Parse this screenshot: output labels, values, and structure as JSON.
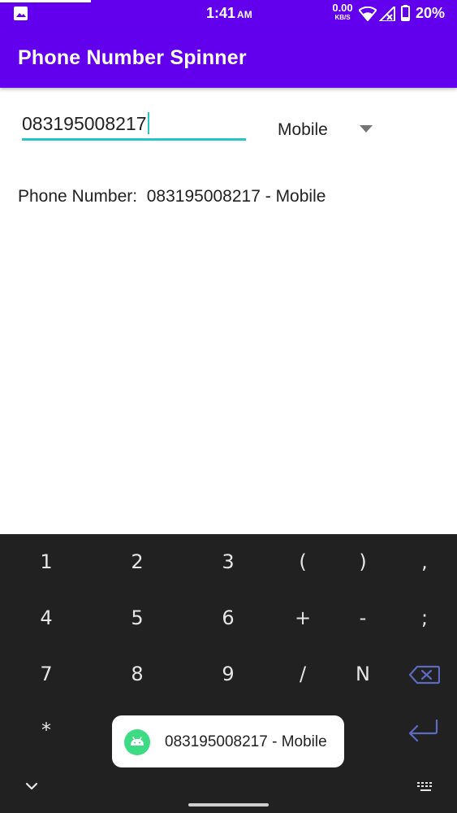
{
  "status_bar": {
    "time": "1:41",
    "ampm": "AM",
    "net_speed_value": "0.00",
    "net_speed_unit": "KB/S",
    "battery": "20%",
    "icons": [
      "gallery-icon",
      "wifi-icon",
      "signal-icon",
      "battery-icon"
    ],
    "background": "#6200EE"
  },
  "app_bar": {
    "title": "Phone Number Spinner",
    "background": "#6200EE"
  },
  "form": {
    "phone_value": "083195008217",
    "accent": "#26C6C6",
    "spinner_selected": "Mobile"
  },
  "result": {
    "text": "Phone Number:  083195008217 - Mobile"
  },
  "keyboard": {
    "rows": [
      [
        "1",
        "2",
        "3",
        "(",
        ")",
        ","
      ],
      [
        "4",
        "5",
        "6",
        "+",
        "-",
        ";"
      ],
      [
        "7",
        "8",
        "9",
        "/",
        "N",
        "backspace-icon"
      ],
      [
        "*",
        "",
        "",
        "",
        "",
        "enter-icon"
      ]
    ],
    "bottom_icons": [
      "chevron-down-icon",
      "keyboard-icon"
    ],
    "accent": "#5C6BC0",
    "background": "#212121"
  },
  "toast": {
    "text": "083195008217 - Mobile",
    "icon": "android-icon"
  }
}
